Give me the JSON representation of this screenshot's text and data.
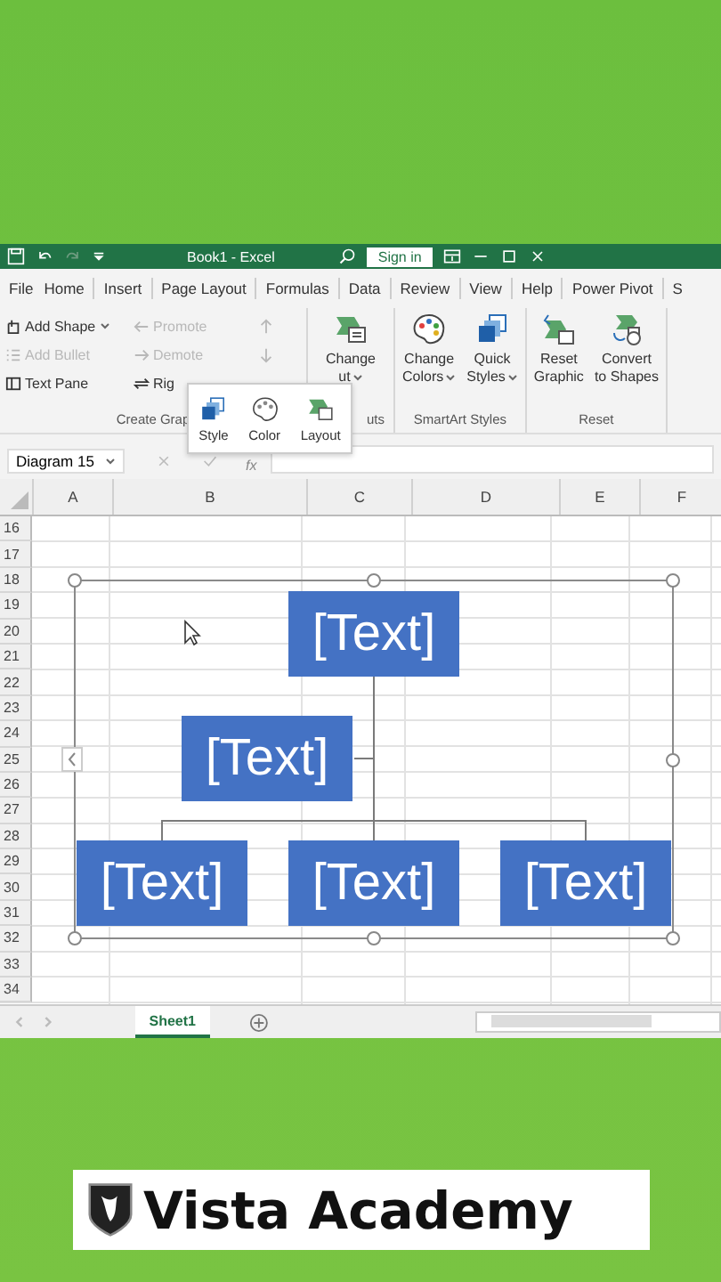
{
  "title_bar": {
    "title": "Book1 - Excel",
    "sign_in": "Sign in"
  },
  "menu_tabs": [
    {
      "label": "File",
      "selected": false
    },
    {
      "label": "Home",
      "selected": false
    },
    {
      "label": "Insert",
      "selected": false
    },
    {
      "label": "Page Layout",
      "selected": false
    },
    {
      "label": "Formulas",
      "selected": false
    },
    {
      "label": "Data",
      "selected": false
    },
    {
      "label": "Review",
      "selected": false
    },
    {
      "label": "View",
      "selected": false
    },
    {
      "label": "Help",
      "selected": false
    },
    {
      "label": "Power Pivot",
      "selected": false
    },
    {
      "label": "S",
      "selected": false
    }
  ],
  "ribbon": {
    "groups": [
      {
        "kind": "small",
        "label": "Create Grap",
        "items": [
          {
            "kind": "add-shape",
            "label": "Add Shape",
            "disabled": false
          },
          {
            "kind": "promote",
            "label": "Promote",
            "disabled": true
          },
          {
            "kind": "move-up",
            "disabled": true
          },
          {
            "kind": "add-bullet",
            "label": "Add Bullet",
            "disabled": true
          },
          {
            "kind": "demote",
            "label": "Demote",
            "disabled": true
          },
          {
            "kind": "move-down",
            "disabled": true
          },
          {
            "kind": "text-pane",
            "label": "Text Pane",
            "disabled": false
          },
          {
            "kind": "right-to-left",
            "label": "Rig",
            "disabled": false
          }
        ]
      },
      {
        "kind": "large",
        "label": "uts",
        "items": [
          {
            "kind": "layout",
            "lines": [
              "Change",
              "ut"
            ],
            "dropdown": true
          }
        ]
      },
      {
        "kind": "large",
        "label": "SmartArt Styles",
        "items": [
          {
            "kind": "colors",
            "lines": [
              "Change",
              "Colors"
            ],
            "dropdown": true
          },
          {
            "kind": "styles",
            "lines": [
              "Quick",
              "Styles"
            ],
            "dropdown": true
          }
        ]
      },
      {
        "kind": "large",
        "label": "Reset",
        "items": [
          {
            "kind": "reset",
            "lines": [
              "Reset",
              "Graphic"
            ],
            "dropdown": false
          },
          {
            "kind": "convert",
            "lines": [
              "Convert",
              "to Shapes"
            ],
            "dropdown": false
          }
        ]
      }
    ]
  },
  "mini_toolbar": [
    {
      "kind": "styles",
      "label": "Style"
    },
    {
      "kind": "colors",
      "label": "Color"
    },
    {
      "kind": "layout",
      "label": "Layout"
    }
  ],
  "formula_bar": {
    "name_box": "Diagram 15",
    "function_label": "fx"
  },
  "grid": {
    "columns": [
      "A",
      "B",
      "C",
      "D",
      "E",
      "F"
    ],
    "rows": [
      "16",
      "17",
      "18",
      "19",
      "20",
      "21",
      "22",
      "23",
      "24",
      "25",
      "26",
      "27",
      "28",
      "29",
      "30",
      "31",
      "32",
      "33",
      "34"
    ]
  },
  "diagram": {
    "text": "[Text]",
    "children": [
      {
        "kind": "assistant",
        "text": "[Text]"
      },
      {
        "kind": "child",
        "text": "[Text]"
      },
      {
        "kind": "child",
        "text": "[Text]"
      },
      {
        "kind": "child",
        "text": "[Text]"
      }
    ]
  },
  "sheet_tabs": [
    {
      "label": "Sheet1",
      "selected": true
    }
  ],
  "branding": {
    "name": "Vista Academy"
  }
}
